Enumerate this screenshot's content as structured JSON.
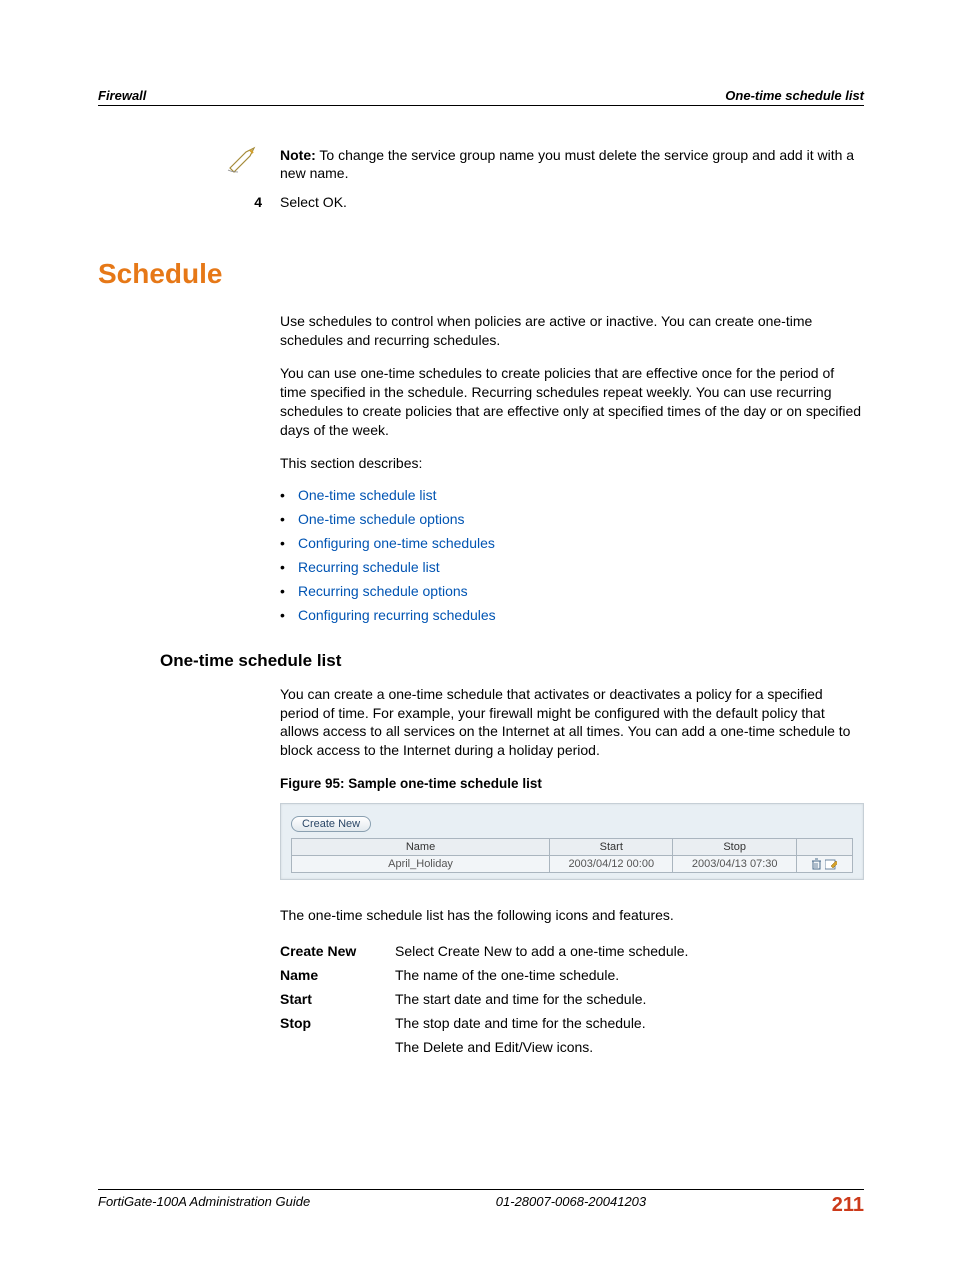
{
  "header": {
    "left": "Firewall",
    "right": "One-time schedule list"
  },
  "note": {
    "bold": "Note:",
    "text": " To change the service group name you must delete the service group and add it with a new name."
  },
  "step": {
    "num": "4",
    "text": "Select OK."
  },
  "h1": "Schedule",
  "p1": "Use schedules to control when policies are active or inactive. You can create one-time schedules and recurring schedules.",
  "p2": "You can use one-time schedules to create policies that are effective once for the period of time specified in the schedule. Recurring schedules repeat weekly. You can use recurring schedules to create policies that are effective only at specified times of the day or on specified days of the week.",
  "p3": "This section describes:",
  "links": [
    "One-time schedule list",
    "One-time schedule options",
    "Configuring one-time schedules",
    "Recurring schedule list",
    "Recurring schedule options",
    "Configuring recurring schedules"
  ],
  "h2": "One-time schedule list",
  "p4": "You can create a one-time schedule that activates or deactivates a policy for a specified period of time. For example, your firewall might be configured with the default policy that allows access to all services on the Internet at all times. You can add a one-time schedule to block access to the Internet during a holiday period.",
  "fig": "Figure 95: Sample one-time schedule list",
  "ss": {
    "btn": "Create New",
    "th": {
      "name": "Name",
      "start": "Start",
      "stop": "Stop"
    },
    "row": {
      "name": "April_Holiday",
      "start": "2003/04/12 00:00",
      "stop": "2003/04/13 07:30"
    }
  },
  "p5": "The one-time schedule list has the following icons and features.",
  "features": [
    {
      "k": "Create New",
      "v": "Select Create New to add a one-time schedule."
    },
    {
      "k": "Name",
      "v": "The name of the one-time schedule."
    },
    {
      "k": "Start",
      "v": "The start date and time for the schedule."
    },
    {
      "k": "Stop",
      "v": "The stop date and time for the schedule."
    },
    {
      "k": "",
      "v": "The Delete and Edit/View icons."
    }
  ],
  "footer": {
    "left": "FortiGate-100A Administration Guide",
    "mid": "01-28007-0068-20041203",
    "pg": "211"
  }
}
